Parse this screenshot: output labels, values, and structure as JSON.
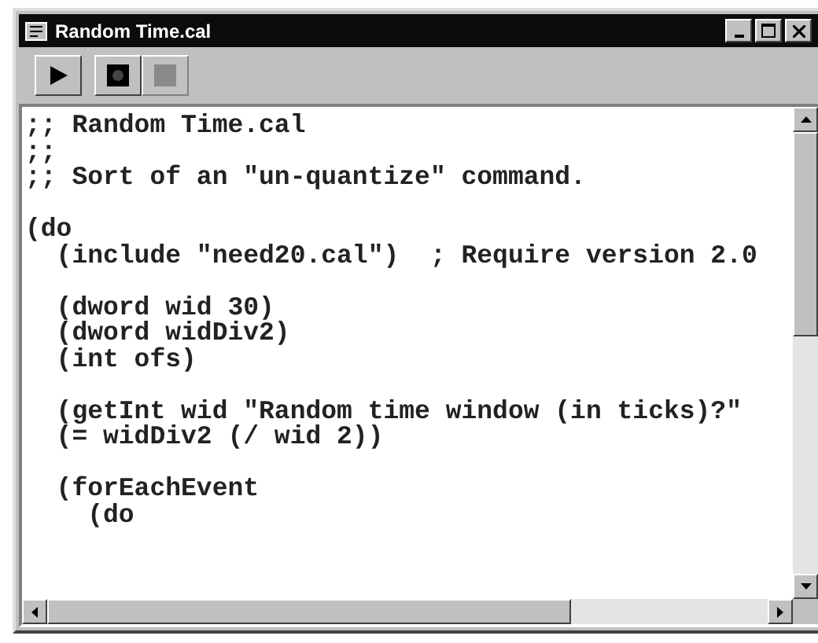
{
  "window": {
    "title": "Random Time.cal"
  },
  "toolbar": [
    {
      "kind": "play",
      "disabled": false
    },
    {
      "kind": "record",
      "disabled": false
    },
    {
      "kind": "stop",
      "disabled": true
    }
  ],
  "code_blocks": [
    [
      ";; Random Time.cal",
      ";;",
      ";; Sort of an \"un-quantize\" command."
    ],
    [
      "(do",
      "  (include \"need20.cal\")  ; Require version 2.0"
    ],
    [
      "  (dword wid 30)",
      "  (dword widDiv2)",
      "  (int ofs)"
    ],
    [
      "  (getInt wid \"Random time window (in ticks)?\"",
      "  (= widDiv2 (/ wid 2))"
    ],
    [
      "  (forEachEvent",
      "    (do"
    ]
  ]
}
